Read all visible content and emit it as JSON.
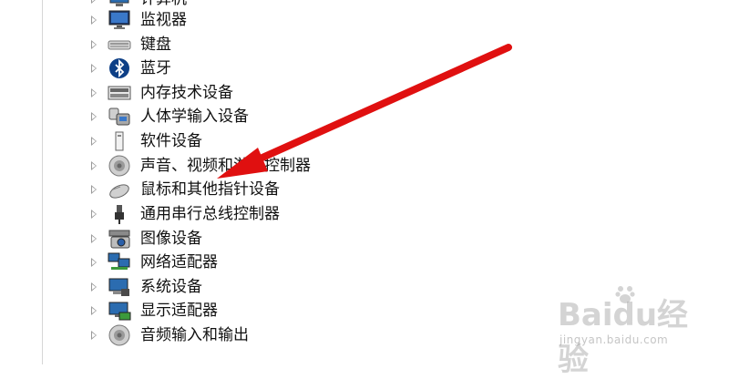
{
  "device_tree": {
    "items": [
      {
        "label": "计算机",
        "icon": "computer-icon"
      },
      {
        "label": "监视器",
        "icon": "monitor-icon"
      },
      {
        "label": "键盘",
        "icon": "keyboard-icon"
      },
      {
        "label": "蓝牙",
        "icon": "bluetooth-icon"
      },
      {
        "label": "内存技术设备",
        "icon": "memory-device-icon"
      },
      {
        "label": "人体学输入设备",
        "icon": "hid-icon"
      },
      {
        "label": "软件设备",
        "icon": "software-device-icon"
      },
      {
        "label": "声音、视频和游戏控制器",
        "icon": "speaker-icon"
      },
      {
        "label": "鼠标和其他指针设备",
        "icon": "mouse-icon"
      },
      {
        "label": "通用串行总线控制器",
        "icon": "usb-icon"
      },
      {
        "label": "图像设备",
        "icon": "camera-icon"
      },
      {
        "label": "网络适配器",
        "icon": "network-adapter-icon"
      },
      {
        "label": "系统设备",
        "icon": "system-device-icon"
      },
      {
        "label": "显示适配器",
        "icon": "display-adapter-icon"
      },
      {
        "label": "音频输入和输出",
        "icon": "audio-io-icon"
      }
    ]
  },
  "annotation": {
    "arrow_color": "#e01010"
  },
  "watermark": {
    "brand": "Baidu经验",
    "url": "jingyan.baidu.com"
  }
}
